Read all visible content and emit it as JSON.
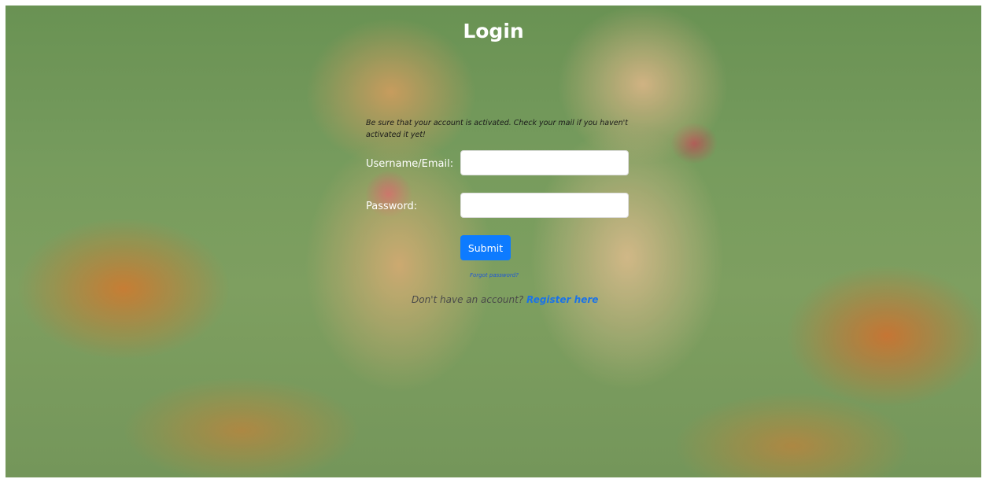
{
  "login": {
    "title": "Login",
    "notice": "Be sure that your account is activated. Check your mail if you haven't activated it yet!",
    "username_label": "Username/Email:",
    "username_value": "",
    "password_label": "Password:",
    "password_value": "",
    "submit_label": "Submit",
    "forgot_label": "Forgot password?",
    "register_prompt": "Don't have an account?",
    "register_link": "Register here"
  },
  "colors": {
    "submit_button": "#0d7bff",
    "register_link": "#1a73e8",
    "title": "#ffffff"
  }
}
